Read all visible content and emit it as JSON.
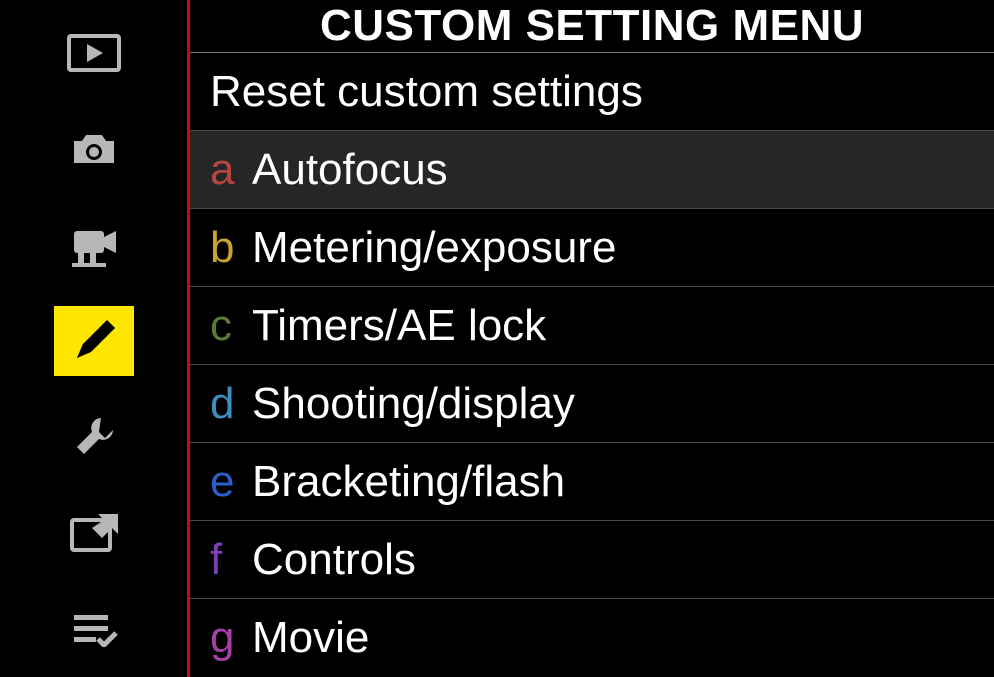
{
  "title": "CUSTOM SETTING MENU",
  "sidebar": {
    "items": [
      {
        "name": "playback-icon",
        "selected": false
      },
      {
        "name": "camera-icon",
        "selected": false
      },
      {
        "name": "video-icon",
        "selected": false
      },
      {
        "name": "pencil-icon",
        "selected": true
      },
      {
        "name": "wrench-icon",
        "selected": false
      },
      {
        "name": "retouch-icon",
        "selected": false
      },
      {
        "name": "mymenu-icon",
        "selected": false
      }
    ]
  },
  "menu": {
    "reset": {
      "label": "Reset custom settings"
    },
    "items": [
      {
        "prefix": "a",
        "prefix_color": "#b8443f",
        "label": "Autofocus",
        "highlight": true
      },
      {
        "prefix": "b",
        "prefix_color": "#c9a22f",
        "label": "Metering/exposure",
        "highlight": false
      },
      {
        "prefix": "c",
        "prefix_color": "#5b7a3a",
        "label": "Timers/AE lock",
        "highlight": false
      },
      {
        "prefix": "d",
        "prefix_color": "#3d8fbf",
        "label": "Shooting/display",
        "highlight": false
      },
      {
        "prefix": "e",
        "prefix_color": "#2a5fc9",
        "label": "Bracketing/flash",
        "highlight": false
      },
      {
        "prefix": "f",
        "prefix_color": "#7a3fb8",
        "label": "Controls",
        "highlight": false
      },
      {
        "prefix": "g",
        "prefix_color": "#a63fa6",
        "label": "Movie",
        "highlight": false
      }
    ]
  }
}
